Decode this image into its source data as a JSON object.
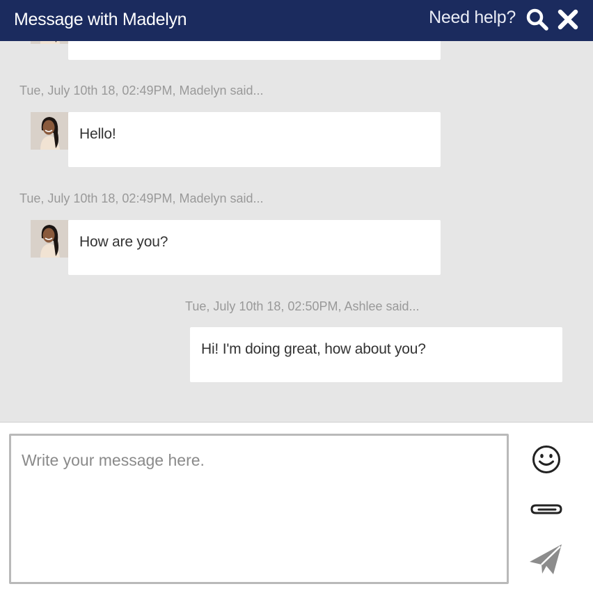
{
  "header": {
    "title": "Message with Madelyn",
    "help_label": "Need help?",
    "search_icon": "search-icon",
    "close_icon": "close-icon",
    "background_color": "#1b2b5e"
  },
  "thread": {
    "messages": [
      {
        "meta": "",
        "text": "",
        "sender": "Madelyn",
        "direction": "incoming"
      },
      {
        "meta": "Tue, July 10th 18, 02:49PM, Madelyn said...",
        "text": "Hello!",
        "sender": "Madelyn",
        "direction": "incoming"
      },
      {
        "meta": "Tue, July 10th 18, 02:49PM, Madelyn said...",
        "text": "How are you?",
        "sender": "Madelyn",
        "direction": "incoming"
      },
      {
        "meta": "Tue, July 10th 18, 02:50PM, Ashlee said...",
        "text": "Hi! I'm doing great, how about you?",
        "sender": "Ashlee",
        "direction": "outgoing"
      }
    ]
  },
  "composer": {
    "placeholder": "Write your message here.",
    "value": "",
    "emoji_icon": "smiley-icon",
    "attach_icon": "paperclip-icon",
    "send_icon": "send-icon"
  }
}
